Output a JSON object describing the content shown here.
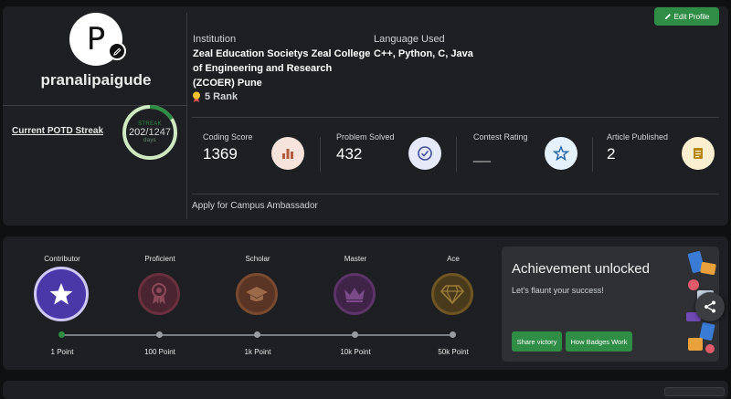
{
  "profile": {
    "avatar_letter": "P",
    "username": "pranalipaigude",
    "streak": {
      "label": "Current POTD Streak",
      "caption": "STREAK",
      "current": "202",
      "total": "/1247",
      "unit": "days",
      "progress": 0.162
    },
    "edit_profile_label": "Edit Profile",
    "institution_label": "Institution",
    "institution_value": "Zeal Education Societys Zeal College of Engineering and Research (ZCOER) Pune",
    "rank_text": "5 Rank",
    "language_label": "Language Used",
    "language_value": "C++, Python, C, Java",
    "stats": [
      {
        "label": "Coding Score",
        "value": "1369",
        "icon": "bar-chart-icon",
        "icon_bg": "#f6e3dc",
        "icon_color": "#b35a3c"
      },
      {
        "label": "Problem Solved",
        "value": "432",
        "icon": "check-circle-icon",
        "icon_bg": "#e6eaf8",
        "icon_color": "#3f4f9c"
      },
      {
        "label": "Contest Rating",
        "value": "__",
        "icon": "star-outline-icon",
        "icon_bg": "#e6f2fb",
        "icon_color": "#2a6aa8"
      },
      {
        "label": "Article Published",
        "value": "2",
        "icon": "article-icon",
        "icon_bg": "#fbefd0",
        "icon_color": "#b8860b"
      }
    ],
    "campus_ambassador_text": "Apply for Campus Ambassador"
  },
  "badges": [
    {
      "name": "Contributor",
      "points": "1 Point",
      "icon": "star-icon",
      "color": "#4b38a8",
      "ring": "#cfc8f5",
      "achieved": true
    },
    {
      "name": "Proficient",
      "points": "100 Point",
      "icon": "ribbon-icon",
      "color": "#4a2430",
      "ring": "#6a3040",
      "achieved": false
    },
    {
      "name": "Scholar",
      "points": "1k Point",
      "icon": "graduation-cap-icon",
      "color": "#5a3424",
      "ring": "#7a4a30",
      "achieved": false
    },
    {
      "name": "Master",
      "points": "10k Point",
      "icon": "crown-icon",
      "color": "#3f2448",
      "ring": "#5c3468",
      "achieved": false
    },
    {
      "name": "Ace",
      "points": "50k Point",
      "icon": "diamond-icon",
      "color": "#4a3a1c",
      "ring": "#6e5624",
      "achieved": false
    }
  ],
  "achievement": {
    "title": "Achievement unlocked",
    "subtitle": "Let's flaunt your success!",
    "share_button": "Share victory",
    "how_button": "How Badges Work"
  },
  "colors": {
    "accent": "#2f8d46",
    "card_bg": "#1d1f22",
    "page_bg": "#0f1012"
  }
}
